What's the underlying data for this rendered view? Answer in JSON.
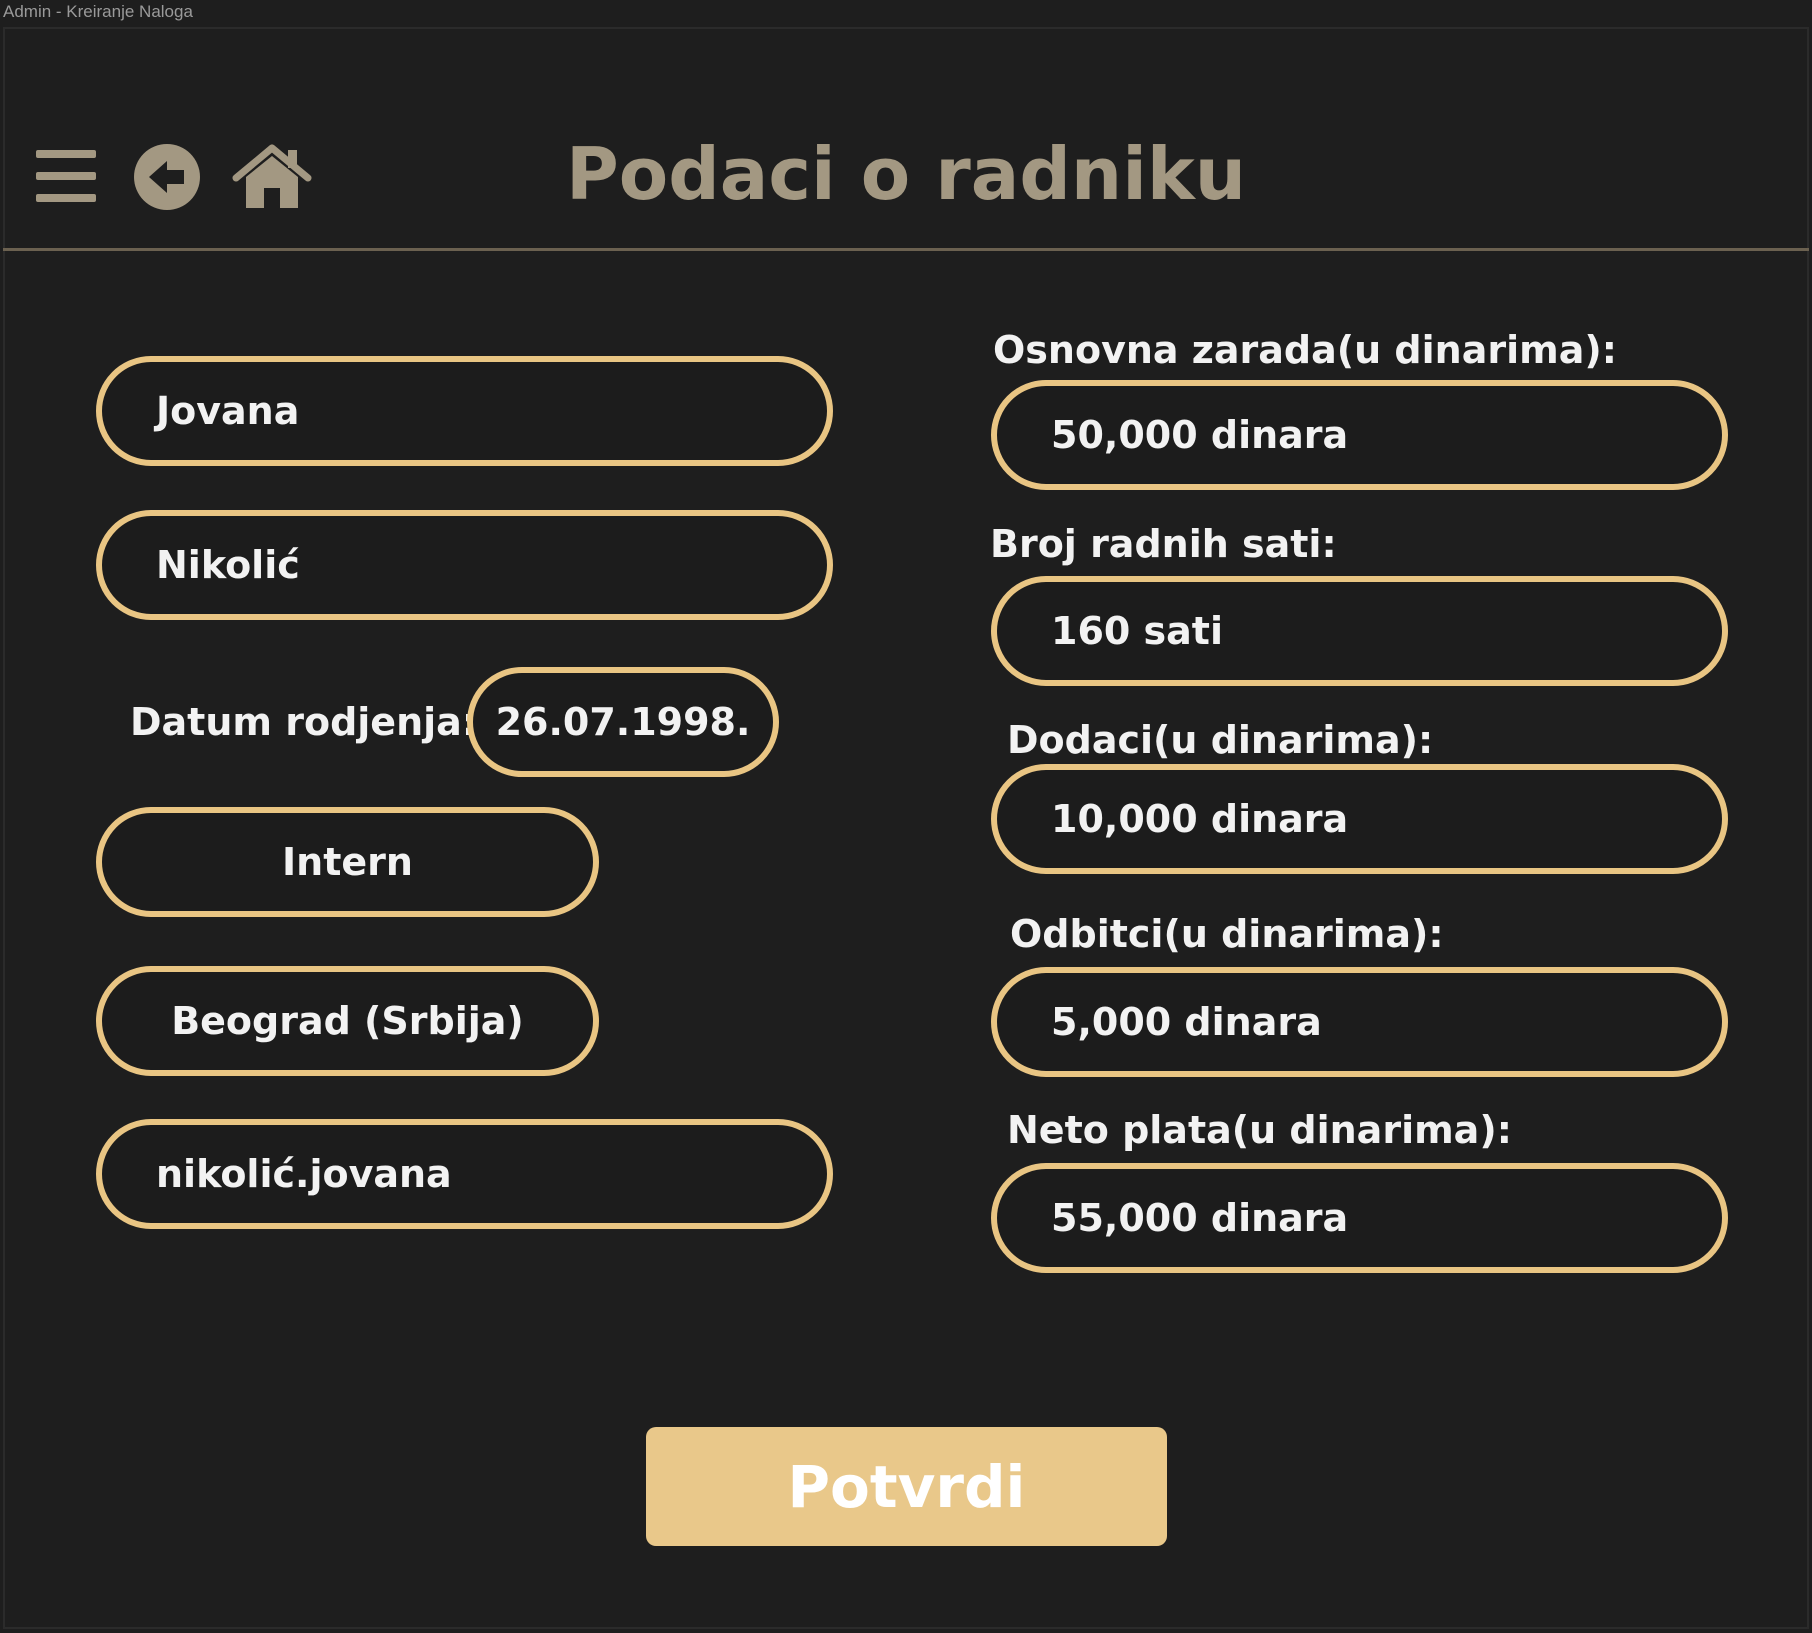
{
  "window": {
    "title": "Admin - Kreiranje Naloga"
  },
  "toolbar": {
    "icons": [
      "menu-icon",
      "back-arrow-icon",
      "home-icon"
    ]
  },
  "header": {
    "title": "Podaci o radniku"
  },
  "left_form": {
    "first_name": "Jovana",
    "last_name": "Nikolić",
    "birth_date_label": "Datum rodjenja:",
    "birth_date": "26.07.1998.",
    "position": "Intern",
    "city": "Beograd (Srbija)",
    "username": "nikolić.jovana"
  },
  "right_form": {
    "base_salary_label": "Osnovna zarada(u dinarima):",
    "base_salary": "50,000 dinara",
    "hours_label": "Broj radnih sati:",
    "hours": "160 sati",
    "bonuses_label": "Dodaci(u dinarima):",
    "bonuses": "10,000 dinara",
    "deductions_label": "Odbitci(u dinarima):",
    "deductions": "5,000 dinara",
    "net_label": "Neto plata(u dinarima):",
    "net": "55,000 dinara"
  },
  "actions": {
    "confirm_label": "Potvrdi"
  },
  "colors": {
    "background": "#1e1e1e",
    "accent": "#e9c583",
    "title": "#a39882",
    "button": "#e9c88a",
    "text": "#f2f2f2"
  }
}
